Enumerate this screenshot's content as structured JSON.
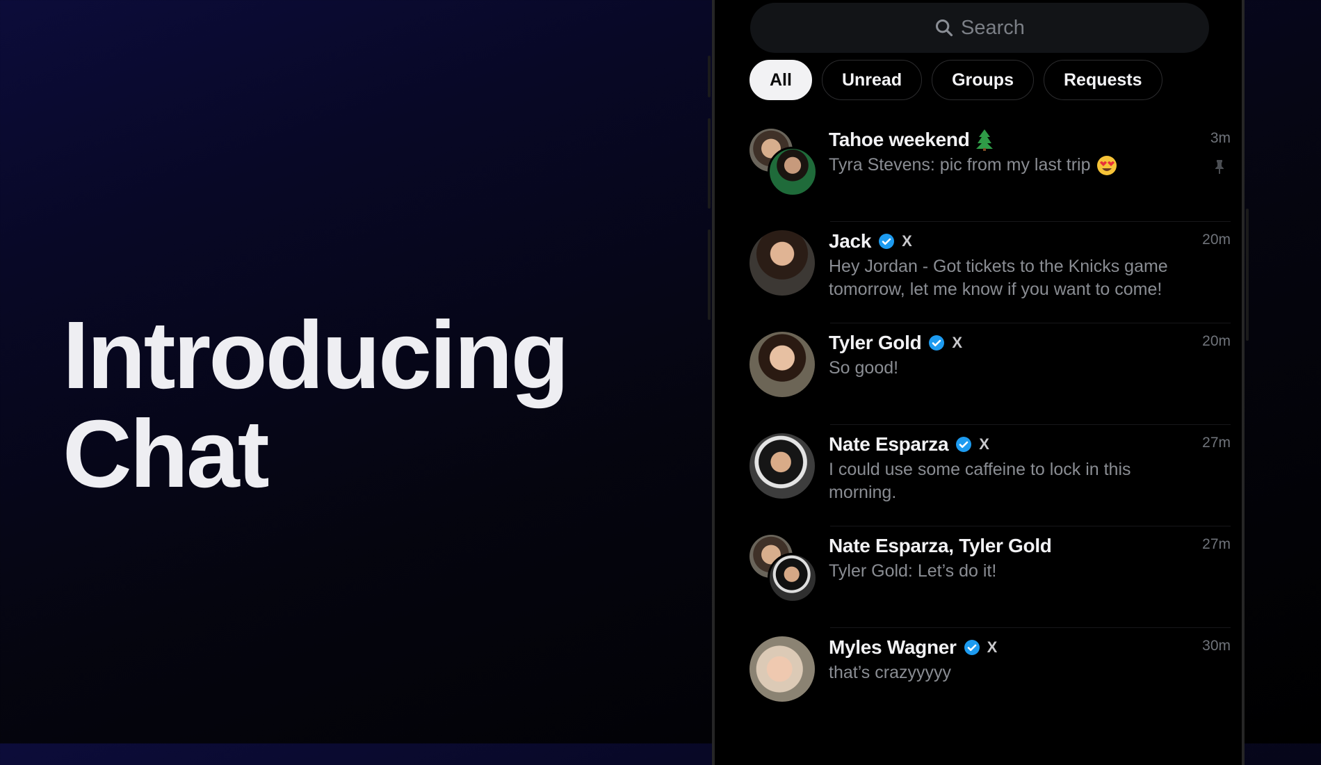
{
  "hero": {
    "line1": "Introducing",
    "line2": "Chat"
  },
  "search": {
    "placeholder": "Search"
  },
  "tabs": [
    {
      "label": "All",
      "active": true
    },
    {
      "label": "Unread",
      "active": false
    },
    {
      "label": "Groups",
      "active": false
    },
    {
      "label": "Requests",
      "active": false
    }
  ],
  "chats": [
    {
      "name": "Tahoe weekend",
      "preview": "Tyra Stevens: pic from my last trip",
      "time": "3m",
      "group": true,
      "icons": [
        "tree-emoji",
        "heart-eyes-emoji",
        "pin-icon"
      ]
    },
    {
      "name": "Jack",
      "verified": true,
      "x_badge": "X",
      "preview": "Hey Jordan - Got tickets to the Knicks game tomorrow, let me know if you want to come!",
      "time": "20m"
    },
    {
      "name": "Tyler Gold",
      "verified": true,
      "x_badge": "X",
      "preview": "So good!",
      "time": "20m"
    },
    {
      "name": "Nate Esparza",
      "verified": true,
      "x_badge": "X",
      "preview": "I could use some caffeine to lock in this morning.",
      "time": "27m"
    },
    {
      "name": "Nate Esparza, Tyler Gold",
      "preview": "Tyler Gold: Let’s do it!",
      "time": "27m",
      "group": true
    },
    {
      "name": "Myles Wagner",
      "verified": true,
      "x_badge": "X",
      "preview": "that’s crazyyyyy",
      "time": "30m"
    }
  ],
  "colors": {
    "verified_blue": "#1d9bf0",
    "tab_active_bg": "#f2f2f4",
    "muted_text": "#8a8d93"
  }
}
